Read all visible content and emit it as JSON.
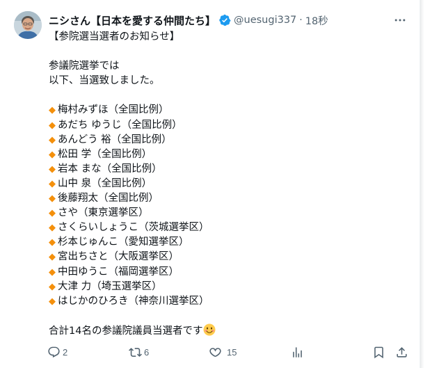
{
  "post": {
    "author": {
      "display_name": "ニシさん【日本を愛する仲間たち】",
      "handle": "@uesugi337",
      "separator": "·",
      "time": "18秒"
    },
    "more_icon": "more-horizontal-icon",
    "text": {
      "headline": "【参院選当選者のお知らせ】",
      "intro_1": "参議院選挙では",
      "intro_2": "以下、当選致しました。",
      "bullet": "◆",
      "winners": [
        "梅村みずほ（全国比例）",
        "あだち ゆうじ（全国比例）",
        "あんどう 裕（全国比例）",
        "松田 学（全国比例）",
        "岩本 まな（全国比例）",
        "山中 泉（全国比例）",
        "後藤翔太（全国比例）",
        "さや（東京選挙区）",
        "さくらいしょうこ（茨城選挙区）",
        "杉本じゅんこ（愛知選挙区）",
        "宮出ちさと（大阪選挙区）",
        "中田ゆうこ（福岡選挙区）",
        "大津 力（埼玉選挙区）",
        "はじかのひろき（神奈川選挙区）"
      ],
      "summary": "合計14名の参議院議員当選者です",
      "summary_emoji": "smiling-face-icon"
    },
    "actions": {
      "replies": "2",
      "reposts": "6",
      "likes": "15"
    },
    "colors": {
      "verified_blue": "#1d9bf0",
      "bullet_orange": "#f4900c",
      "secondary_text": "#536471"
    }
  }
}
